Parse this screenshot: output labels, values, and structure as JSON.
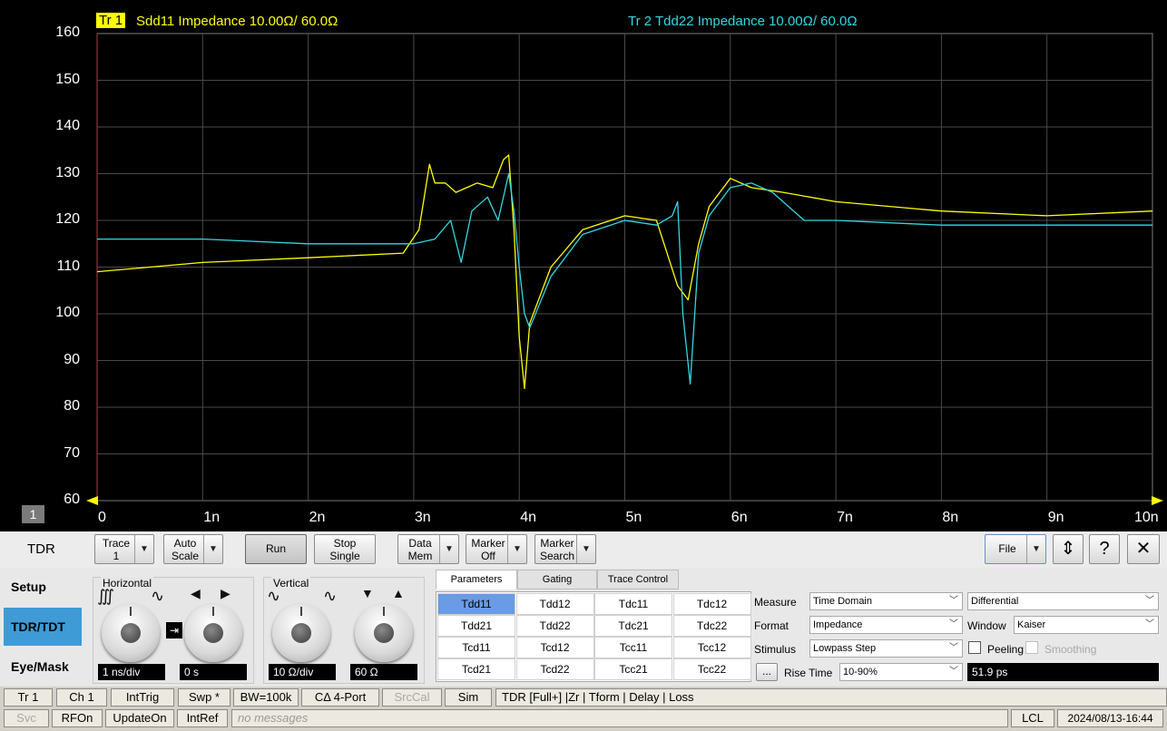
{
  "trace1": {
    "tag": "Tr 1",
    "label": "Sdd11 Impedance 10.00Ω/  60.0Ω",
    "color": "#ffff00"
  },
  "trace2": {
    "label": "Tr 2  Tdd22 Impedance 10.00Ω/  60.0Ω",
    "color": "#32d8e0"
  },
  "channel_number": "1",
  "plot": {
    "y_ticks": [
      "160",
      "150",
      "140",
      "130",
      "120",
      "110",
      "100",
      "90",
      "80",
      "70",
      "60"
    ],
    "x_ticks": [
      "0",
      "1n",
      "2n",
      "3n",
      "4n",
      "5n",
      "6n",
      "7n",
      "8n",
      "9n",
      "10n"
    ]
  },
  "chart_data": {
    "type": "line",
    "xlabel": "",
    "ylabel": "",
    "xlim": [
      0,
      10
    ],
    "ylim": [
      60,
      160
    ],
    "x_unit": "ns",
    "y_unit": "Ω",
    "grid": true,
    "series": [
      {
        "name": "Sdd11",
        "color": "#ffff00",
        "x": [
          0,
          1,
          2,
          2.9,
          3.05,
          3.1,
          3.15,
          3.2,
          3.3,
          3.4,
          3.6,
          3.75,
          3.85,
          3.9,
          3.95,
          4.0,
          4.05,
          4.1,
          4.3,
          4.6,
          5.0,
          5.3,
          5.5,
          5.6,
          5.7,
          5.8,
          6.0,
          6.2,
          6.5,
          7.0,
          8.0,
          9.0,
          10.0
        ],
        "y": [
          109,
          111,
          112,
          113,
          118,
          125,
          132,
          128,
          128,
          126,
          128,
          127,
          133,
          134,
          118,
          95,
          84,
          98,
          110,
          118,
          121,
          120,
          106,
          103,
          115,
          123,
          129,
          127,
          126,
          124,
          122,
          121,
          122
        ]
      },
      {
        "name": "Tdd22",
        "color": "#32d8e0",
        "x": [
          0,
          1,
          2,
          3.0,
          3.2,
          3.35,
          3.45,
          3.55,
          3.7,
          3.8,
          3.9,
          3.95,
          4.0,
          4.05,
          4.1,
          4.3,
          4.6,
          5.0,
          5.3,
          5.45,
          5.5,
          5.55,
          5.62,
          5.7,
          5.8,
          6.0,
          6.2,
          6.4,
          6.7,
          7.0,
          8.0,
          9.0,
          10.0
        ],
        "y": [
          116,
          116,
          115,
          115,
          116,
          120,
          111,
          122,
          125,
          120,
          130,
          122,
          110,
          100,
          97,
          108,
          117,
          120,
          119,
          121,
          124,
          100,
          85,
          113,
          121,
          127,
          128,
          126,
          120,
          120,
          119,
          119,
          119
        ]
      }
    ]
  },
  "toolbar": {
    "title": "TDR",
    "trace_btn": [
      "Trace",
      "1"
    ],
    "autoscale_btn": [
      "Auto",
      "Scale"
    ],
    "run_btn": "Run",
    "stop_btn": [
      "Stop",
      "Single"
    ],
    "datamem_btn": [
      "Data",
      "Mem"
    ],
    "marker_btn": [
      "Marker",
      "Off"
    ],
    "search_btn": [
      "Marker",
      "Search"
    ],
    "file_btn": "File",
    "help_btn": "?",
    "resize_glyph": "⇕",
    "close_glyph": "✕"
  },
  "sidebar": {
    "items": [
      "Setup",
      "TDR/TDT",
      "Eye/Mask"
    ],
    "active": 1
  },
  "horizontal": {
    "title": "Horizontal",
    "scale": "1 ns/div",
    "position": "0 s"
  },
  "vertical": {
    "title": "Vertical",
    "scale": "10 Ω/div",
    "offset": "60 Ω"
  },
  "tabs": [
    "Parameters",
    "Gating",
    "Trace Control"
  ],
  "parameters": [
    [
      "Tdd11",
      "Tdd12",
      "Tdc11",
      "Tdc12"
    ],
    [
      "Tdd21",
      "Tdd22",
      "Tdc21",
      "Tdc22"
    ],
    [
      "Tcd11",
      "Tcd12",
      "Tcc11",
      "Tcc12"
    ],
    [
      "Tcd21",
      "Tcd22",
      "Tcc21",
      "Tcc22"
    ]
  ],
  "settings": {
    "measure_label": "Measure",
    "measure_value": "Time Domain",
    "measure_mode": "Differential",
    "format_label": "Format",
    "format_value": "Impedance",
    "window_label": "Window",
    "window_value": "Kaiser",
    "stimulus_label": "Stimulus",
    "stimulus_value": "Lowpass Step",
    "peeling_label": "Peeling",
    "smoothing_label": "Smoothing",
    "more_btn": "...",
    "risetime_label": "Rise Time",
    "risetime_value": "10-90%",
    "risetime_ps": "51.9 ps"
  },
  "status_row1": [
    "Tr 1",
    "Ch 1",
    "IntTrig",
    "Swp *",
    "BW=100k",
    "CΔ 4-Port",
    "SrcCal",
    "Sim",
    "TDR [Full+] |Zr | Tform | Delay | Loss"
  ],
  "status_row2": {
    "svc": "Svc",
    "rfon": "RFOn",
    "update": "UpdateOn",
    "intref": "IntRef",
    "message": "no messages",
    "lcl": "LCL",
    "datetime": "2024/08/13-16:44"
  }
}
